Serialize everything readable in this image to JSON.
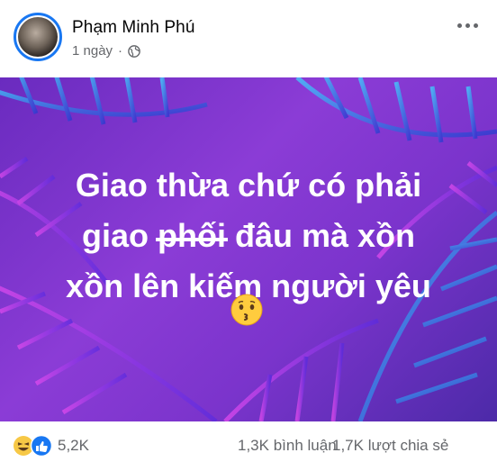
{
  "post": {
    "author": "Phạm Minh Phú",
    "time": "1 ngày",
    "separator": "·",
    "privacy_icon": "globe-icon",
    "more_icon": "more-options-icon"
  },
  "content": {
    "line1": "Giao thừa chứ có phải",
    "line2_pre": "giao ",
    "line2_strike": "phối",
    "line2_post": " đâu mà xồn",
    "line3": "xồn lên kiếm người yêu",
    "emoji": "kissing-face-emoji",
    "colors": {
      "background": "#7b34cc",
      "text": "#ffffff"
    }
  },
  "stats": {
    "reaction_icons": [
      "haha-reaction-icon",
      "like-reaction-icon"
    ],
    "reactions": "5,2K",
    "comments": "1,3K bình luận",
    "shares": "1,7K lượt chia sẻ"
  },
  "colors": {
    "accent": "#1877f2",
    "secondary_text": "#65676b"
  }
}
